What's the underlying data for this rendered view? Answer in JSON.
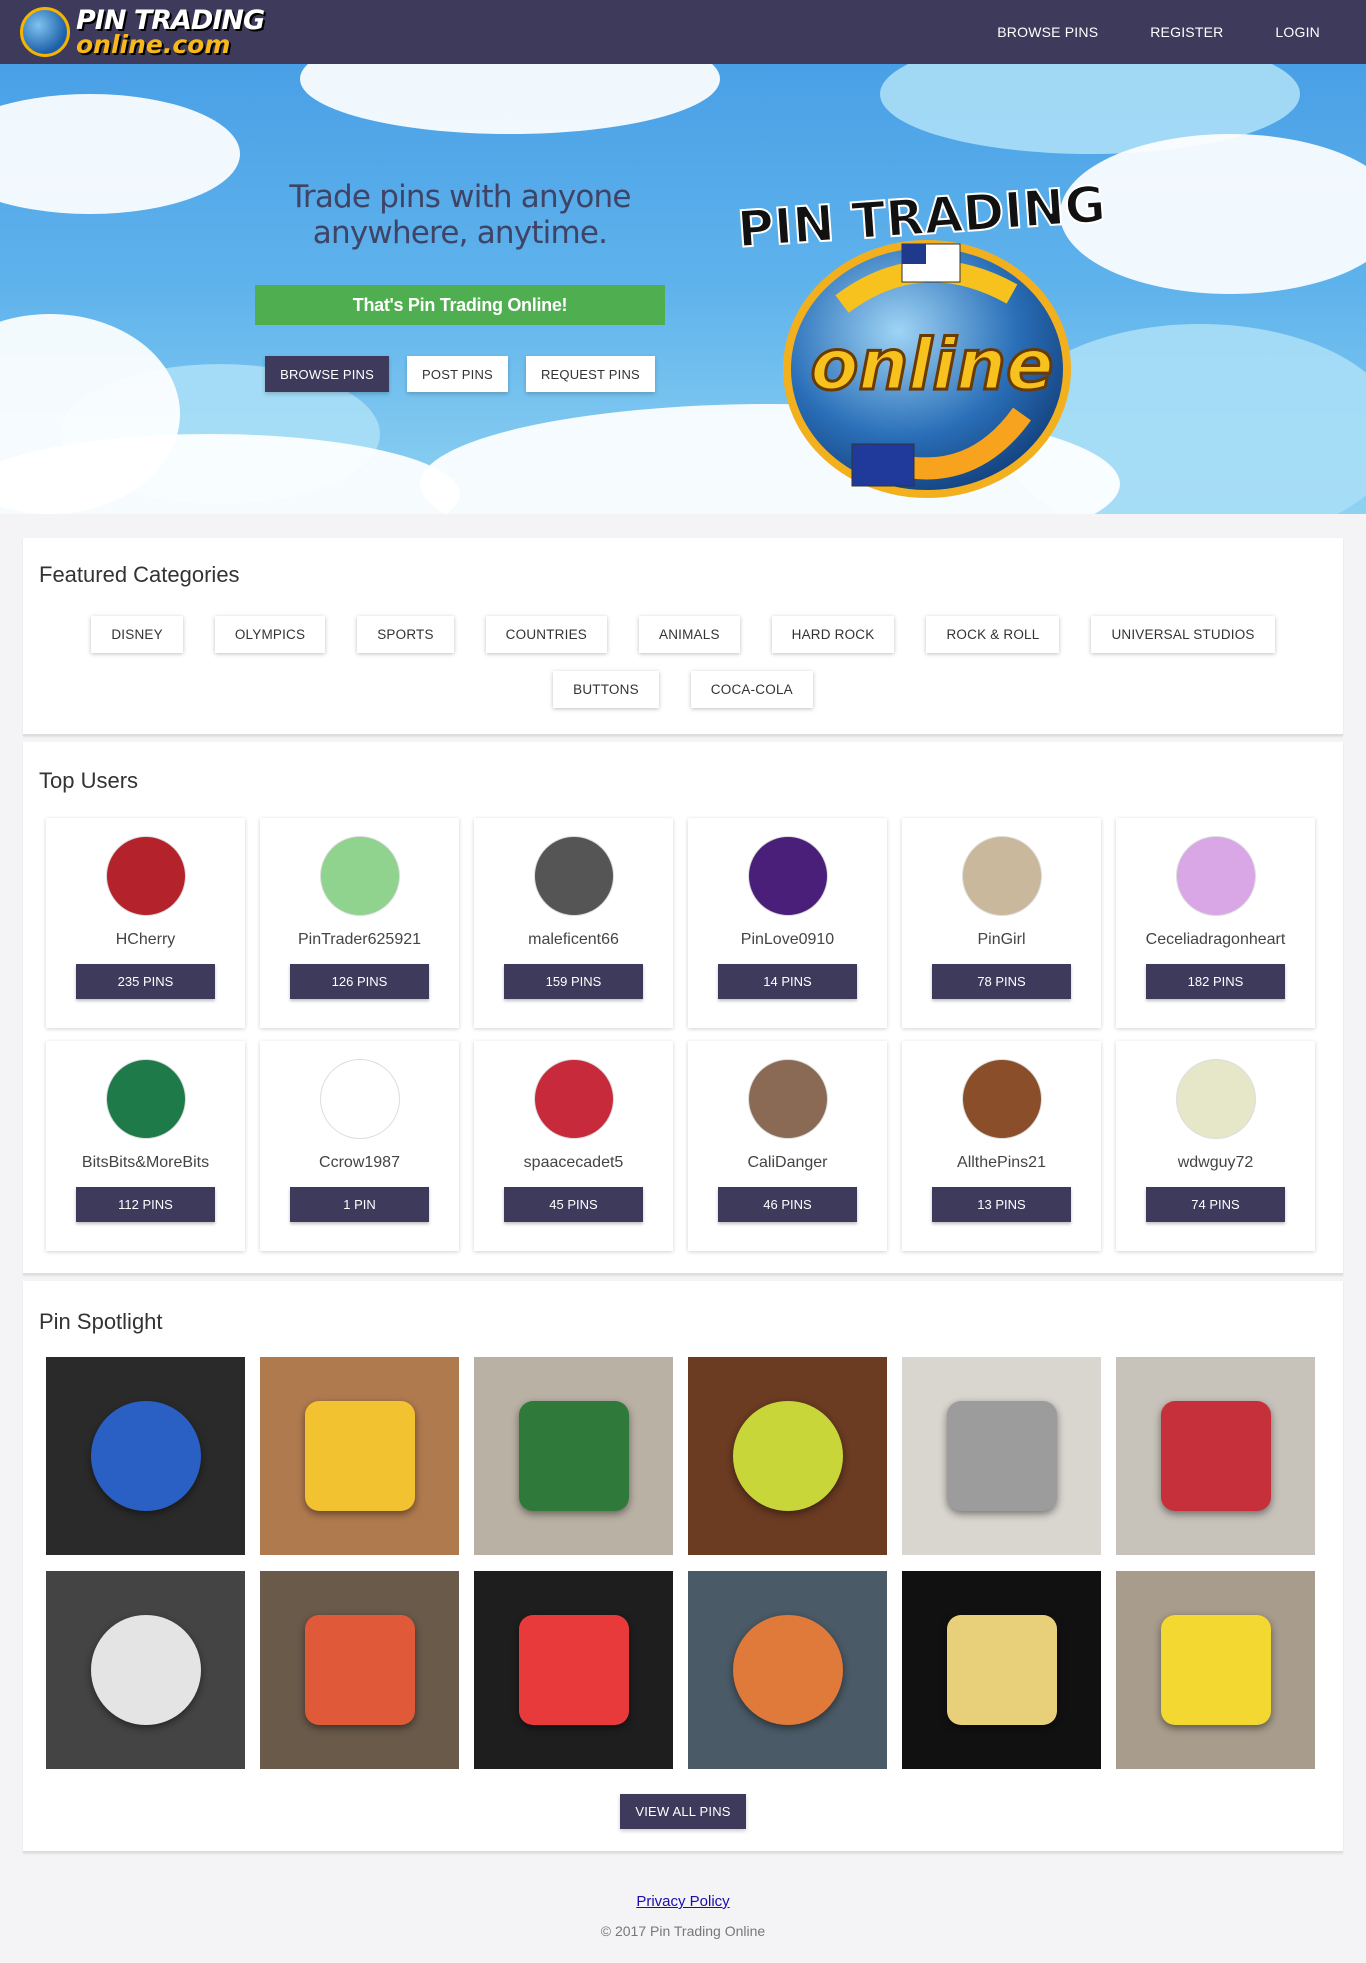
{
  "header": {
    "logo_line1": "PIN TRADING",
    "logo_line2": "online.com",
    "nav": [
      "BROWSE PINS",
      "REGISTER",
      "LOGIN"
    ]
  },
  "hero": {
    "tagline_line1": "Trade pins with anyone",
    "tagline_line2": "anywhere, anytime.",
    "green_text": "That's Pin Trading Online!",
    "buttons": [
      "BROWSE PINS",
      "POST PINS",
      "REQUEST PINS"
    ],
    "logo_top": "PIN TRADING",
    "logo_bottom": "online"
  },
  "featured": {
    "title": "Featured Categories",
    "categories": [
      "DISNEY",
      "OLYMPICS",
      "SPORTS",
      "COUNTRIES",
      "ANIMALS",
      "HARD ROCK",
      "ROCK & ROLL",
      "UNIVERSAL STUDIOS",
      "BUTTONS",
      "COCA-COLA"
    ]
  },
  "top_users": {
    "title": "Top Users",
    "users": [
      {
        "name": "HCherry",
        "pins": "235 PINS",
        "color": "#b4232b"
      },
      {
        "name": "PinTrader625921",
        "pins": "126 PINS",
        "color": "#8fd38f"
      },
      {
        "name": "maleficent66",
        "pins": "159 PINS",
        "color": "#555555"
      },
      {
        "name": "PinLove0910",
        "pins": "14 PINS",
        "color": "#4a1f7a"
      },
      {
        "name": "PinGirl",
        "pins": "78 PINS",
        "color": "#c9b89b"
      },
      {
        "name": "Ceceliadragonheart",
        "pins": "182 PINS",
        "color": "#d9a6e6"
      },
      {
        "name": "BitsBits&MoreBits",
        "pins": "112 PINS",
        "color": "#1f7a4a"
      },
      {
        "name": "Ccrow1987",
        "pins": "1 PIN",
        "color": "#ffffff"
      },
      {
        "name": "spaacecadet5",
        "pins": "45 PINS",
        "color": "#c72a3a"
      },
      {
        "name": "CaliDanger",
        "pins": "46 PINS",
        "color": "#8a6a55"
      },
      {
        "name": "AllthePins21",
        "pins": "13 PINS",
        "color": "#8a4f2a"
      },
      {
        "name": "wdwguy72",
        "pins": "74 PINS",
        "color": "#e6e6c8"
      }
    ]
  },
  "spotlight": {
    "title": "Pin Spotlight",
    "pins": [
      {
        "bg": "#2a2a2a",
        "fg": "#2a5fc4"
      },
      {
        "bg": "#b07a4f",
        "fg": "#f2c230"
      },
      {
        "bg": "#b9b1a4",
        "fg": "#2f7a3a"
      },
      {
        "bg": "#6b3b22",
        "fg": "#c9d63a"
      },
      {
        "bg": "#d9d5cf",
        "fg": "#9c9c9c"
      },
      {
        "bg": "#c7c2ba",
        "fg": "#c6303a"
      },
      {
        "bg": "#444444",
        "fg": "#e4e4e4"
      },
      {
        "bg": "#6a5a4a",
        "fg": "#e05a3a"
      },
      {
        "bg": "#1e1e1e",
        "fg": "#e83a3a"
      },
      {
        "bg": "#4a5a66",
        "fg": "#e07a3a"
      },
      {
        "bg": "#111111",
        "fg": "#e8d07a"
      },
      {
        "bg": "#a89c8c",
        "fg": "#f2d830"
      }
    ],
    "view_all": "VIEW ALL PINS"
  },
  "footer": {
    "privacy": "Privacy Policy",
    "copyright": "© 2017 Pin Trading Online"
  }
}
